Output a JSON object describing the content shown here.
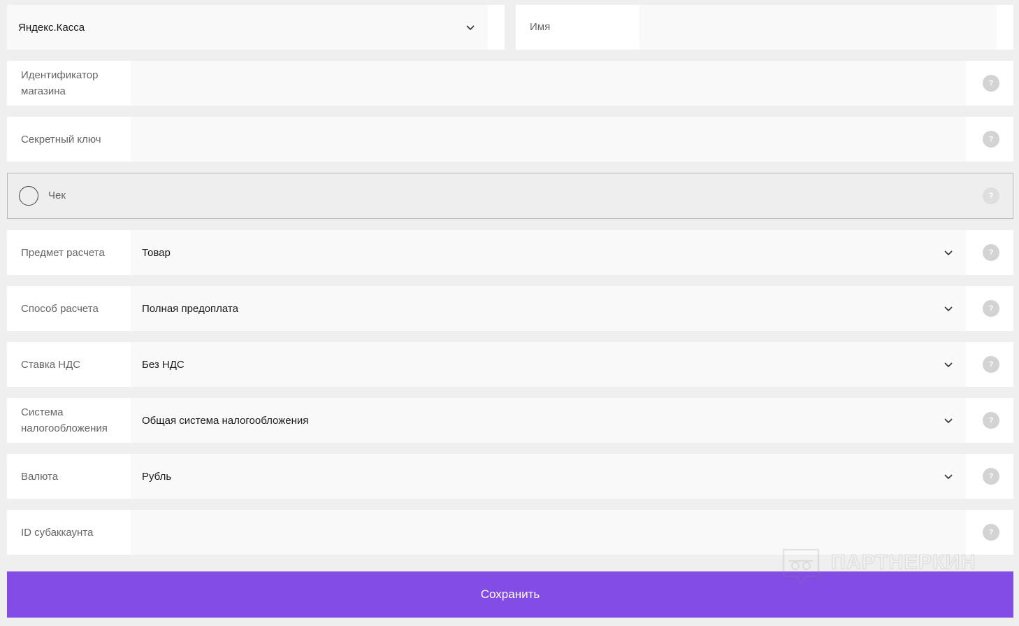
{
  "provider": {
    "selected": "Яндекс.Касса"
  },
  "name_field": {
    "label": "Имя",
    "value": ""
  },
  "fields": {
    "shop_id": {
      "label": "Идентификатор магазина",
      "value": ""
    },
    "secret_key": {
      "label": "Секретный ключ",
      "value": ""
    },
    "payment_subject": {
      "label": "Предмет расчета",
      "value": "Товар"
    },
    "payment_method": {
      "label": "Способ расчета",
      "value": "Полная предоплата"
    },
    "vat_rate": {
      "label": "Ставка НДС",
      "value": "Без НДС"
    },
    "tax_system": {
      "label": "Система налогообложения",
      "value": "Общая система налогообложения"
    },
    "currency": {
      "label": "Валюта",
      "value": "Рубль"
    },
    "subaccount_id": {
      "label": "ID субаккаунта",
      "value": ""
    }
  },
  "receipt": {
    "label": "Чек",
    "checked": false
  },
  "help_glyph": "?",
  "watermark": {
    "text": "ПАРТНЕРКИН"
  },
  "save_button": {
    "label": "Сохранить"
  },
  "colors": {
    "accent": "#834ce4",
    "background": "#efefef",
    "field": "#f9f9f9"
  }
}
